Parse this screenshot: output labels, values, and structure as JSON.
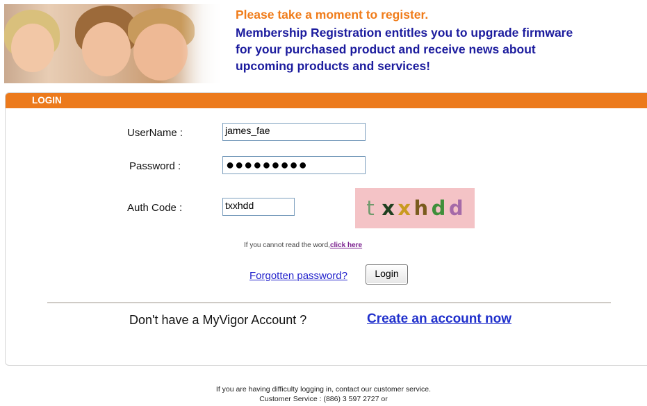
{
  "header": {
    "title": "Please take a moment to register.",
    "body": [
      "Membership Registration entitles you to upgrade firmware",
      "for your purchased product and receive news about",
      "upcoming products and services!"
    ],
    "image": "children-photo"
  },
  "login": {
    "section_title": "LOGIN",
    "username_label": "UserName :",
    "username_value": "james_fae",
    "password_label": "Password :",
    "password_mask": "●●●●●●●●●",
    "authcode_label": "Auth Code :",
    "authcode_value": "txxhdd",
    "captcha_letters": [
      {
        "ch": "t",
        "color": "#6f9a6c"
      },
      {
        "ch": "x",
        "color": "#1f3f1f"
      },
      {
        "ch": "x",
        "color": "#c99a1e"
      },
      {
        "ch": "h",
        "color": "#7a5b1e"
      },
      {
        "ch": "d",
        "color": "#3f8f3a"
      },
      {
        "ch": "d",
        "color": "#a56aa8"
      }
    ],
    "hint_text": "If you cannot read the word,",
    "hint_link": "click here",
    "forgot_link": "Forgotten password?",
    "login_button": "Login",
    "no_account_text": "Don't have a MyVigor Account ?",
    "create_link": "Create an account now"
  },
  "footer": {
    "line1": "If you are having difficulty logging in, contact our customer service.",
    "line2": "Customer Service : (886) 3 597 2727 or"
  },
  "colors": {
    "accent_orange": "#ec7a1c",
    "heading_orange": "#f07c1a",
    "heading_blue": "#1c1c9e",
    "link_blue": "#1f2fcc"
  }
}
